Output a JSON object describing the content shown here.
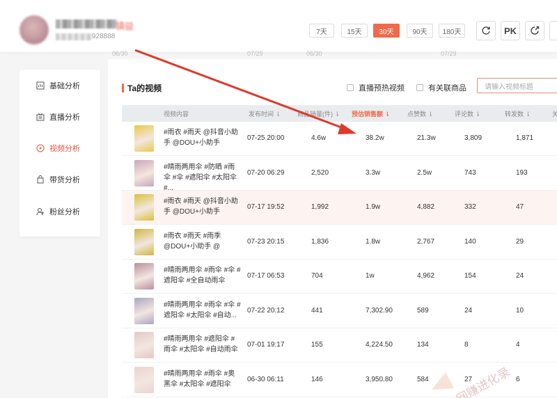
{
  "profile": {
    "name_suffix": "镇益",
    "id_suffix": "928888"
  },
  "date_ranges": [
    {
      "label": "7天",
      "active": false
    },
    {
      "label": "15天",
      "active": false
    },
    {
      "label": "30天",
      "active": true
    },
    {
      "label": "90天",
      "active": false
    },
    {
      "label": "180天",
      "active": false
    }
  ],
  "toolbar": {
    "refresh_icon": "refresh-icon",
    "pk_label": "PK",
    "export_icon": "export-icon"
  },
  "axis_ticks": [
    "06/30",
    "07/29",
    "06/30",
    "07/29"
  ],
  "sidebar": {
    "items": [
      {
        "label": "基础分析",
        "icon": "chart-icon",
        "active": false
      },
      {
        "label": "直播分析",
        "icon": "live-icon",
        "active": false
      },
      {
        "label": "视频分析",
        "icon": "video-icon",
        "active": true
      },
      {
        "label": "带货分析",
        "icon": "bag-icon",
        "active": false
      },
      {
        "label": "粉丝分析",
        "icon": "fans-icon",
        "active": false
      }
    ]
  },
  "section": {
    "title": "Ta的视频",
    "filter_live": "直播预热视频",
    "filter_goods": "有关联商品",
    "search_placeholder": "请输入视频标题"
  },
  "table": {
    "columns": [
      "视频内容",
      "发布时间 ⇂",
      "商品销量(件) ⇂",
      "预估销售额 ⇂",
      "点赞数 ⇂",
      "评论数 ⇂",
      "转发数 ⇂",
      "关"
    ],
    "rows": [
      {
        "desc": "#雨衣 #雨天 @抖音小助手 @DOU+小助手",
        "time": "07-25 20:00",
        "sales": "4.6w",
        "revenue": "38.2w",
        "likes": "21.3w",
        "comments": "3,809",
        "shares": "1,871",
        "thumb": "#e8c94a"
      },
      {
        "desc": "#晴雨两用伞 #防晒 #雨伞 #伞 #遮阳伞 #太阳伞 #...",
        "time": "07-20 06:29",
        "sales": "2,520",
        "revenue": "3.3w",
        "likes": "2.5w",
        "comments": "743",
        "shares": "193",
        "thumb": "#c9a7b8"
      },
      {
        "desc": "#雨衣 #雨天 @抖音小助手 @DOU+小助手",
        "time": "07-17 19:52",
        "sales": "1,992",
        "revenue": "1.9w",
        "likes": "4,882",
        "comments": "332",
        "shares": "47",
        "thumb": "#d9c23a"
      },
      {
        "desc": "#雨衣 #雨天 #雨季 @DOU+小助手 @",
        "time": "07-23 20:15",
        "sales": "1,836",
        "revenue": "1.8w",
        "likes": "2,767",
        "comments": "140",
        "shares": "29",
        "thumb": "#cfb640"
      },
      {
        "desc": "#晴雨两用伞 #雨伞 #伞 #遮阳伞 #全自动雨伞",
        "time": "07-17 06:53",
        "sales": "704",
        "revenue": "1w",
        "likes": "4,962",
        "comments": "154",
        "shares": "24",
        "thumb": "#b98f9f"
      },
      {
        "desc": "#晴雨两用伞 #雨伞 #伞 #遮阳伞 #太阳伞 #自动...",
        "time": "07-22 20:12",
        "sales": "441",
        "revenue": "7,302.90",
        "likes": "589",
        "comments": "24",
        "shares": "10",
        "thumb": "#a8a6c4"
      },
      {
        "desc": "#晴雨两用伞 #遮阳伞 #雨伞 #太阳伞 #自动雨伞",
        "time": "07-01 19:17",
        "sales": "155",
        "revenue": "4,224.50",
        "likes": "134",
        "comments": "8",
        "shares": "4",
        "thumb": "#e7c6c6"
      },
      {
        "desc": "#晴雨两用伞 #雨伞 #奥黑伞 #太阳伞 #遮阳伞",
        "time": "06-30 06:11",
        "sales": "146",
        "revenue": "3,950.80",
        "likes": "584",
        "comments": "27",
        "shares": "6",
        "thumb": "#ecd3d3"
      }
    ]
  },
  "watermark": "网赚进化录",
  "colors": {
    "accent": "#ee6a4c",
    "arrow": "#e0392b"
  }
}
